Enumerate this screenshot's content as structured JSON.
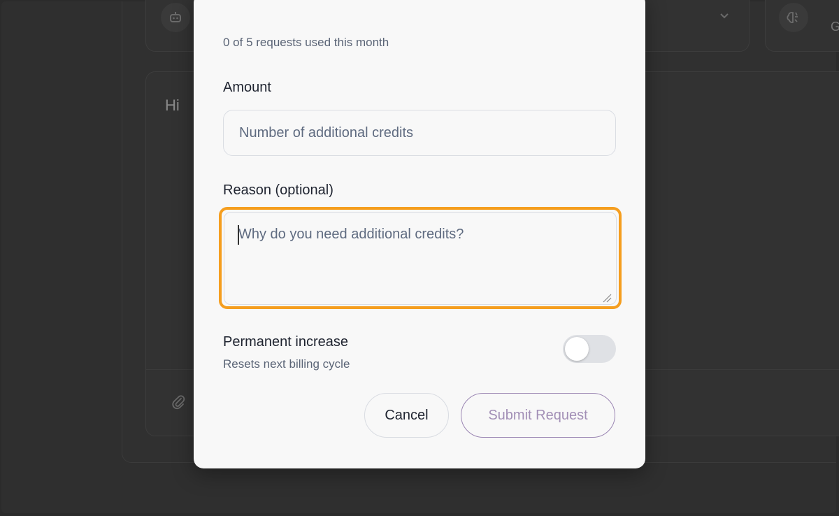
{
  "background": {
    "chat_text": "Hi",
    "side_letter": "G",
    "icons": {
      "model": "robot-icon",
      "chevron": "chevron-down-icon",
      "tool": "brain-icon",
      "attach": "paperclip-icon"
    }
  },
  "modal": {
    "usage_text": "0 of 5 requests used this month",
    "amount": {
      "label": "Amount",
      "placeholder": "Number of additional credits",
      "value": ""
    },
    "reason": {
      "label": "Reason (optional)",
      "placeholder": "Why do you need additional credits?",
      "value": ""
    },
    "permanent": {
      "title": "Permanent increase",
      "subtitle": "Resets next billing cycle",
      "enabled": false
    },
    "buttons": {
      "cancel": "Cancel",
      "submit": "Submit Request"
    },
    "colors": {
      "focus_ring": "#f59e1f",
      "submit_border": "#9b86b3",
      "submit_text": "#a28fb6"
    }
  }
}
